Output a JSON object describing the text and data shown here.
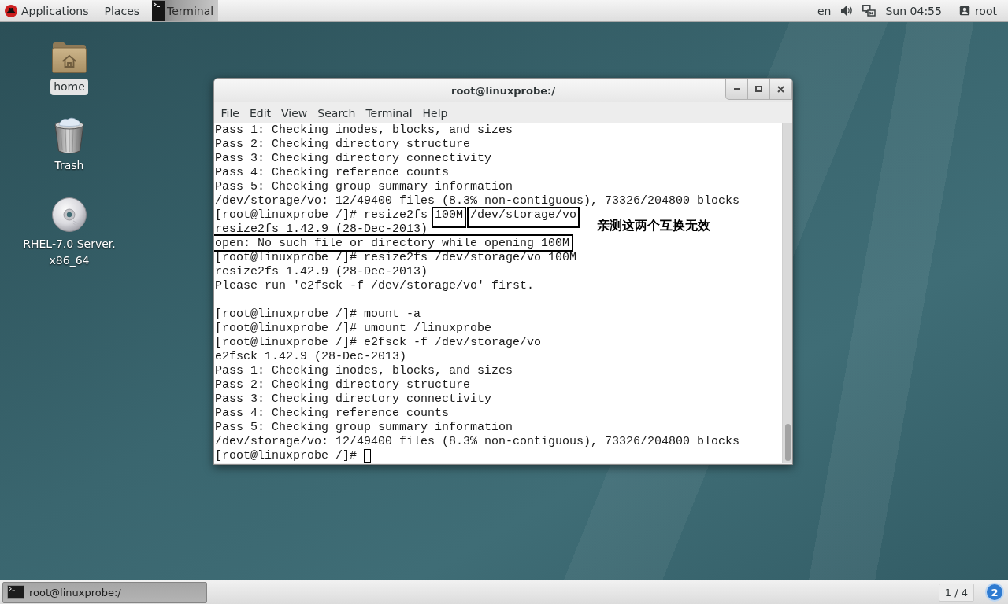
{
  "top_bar": {
    "menus": [
      {
        "kind": "apps",
        "label": "Applications"
      },
      {
        "kind": "places",
        "label": "Places"
      }
    ],
    "app_menu": {
      "label": "Terminal"
    },
    "input_source": "en",
    "clock": "Sun 04:55",
    "user": "root"
  },
  "desktop_icons": [
    {
      "kind": "folder",
      "label_lines": [
        "home"
      ],
      "selected": true
    },
    {
      "kind": "trash",
      "label_lines": [
        "Trash"
      ],
      "selected": false
    },
    {
      "kind": "disc",
      "label_lines": [
        "RHEL-7.0 Server.",
        "x86_64"
      ],
      "selected": false
    }
  ],
  "terminal": {
    "title": "root@linuxprobe:/",
    "menu": [
      "File",
      "Edit",
      "View",
      "Search",
      "Terminal",
      "Help"
    ],
    "lines": [
      {
        "kind": "text",
        "text": "Pass 1: Checking inodes, blocks, and sizes",
        "boxed": false
      },
      {
        "kind": "text",
        "text": "Pass 2: Checking directory structure",
        "boxed": false
      },
      {
        "kind": "text",
        "text": "Pass 3: Checking directory connectivity",
        "boxed": false
      },
      {
        "kind": "text",
        "text": "Pass 4: Checking reference counts",
        "boxed": false
      },
      {
        "kind": "text",
        "text": "Pass 5: Checking group summary information",
        "boxed": false
      },
      {
        "kind": "text",
        "text": "/dev/storage/vo: 12/49400 files (8.3% non-contiguous), 73326/204800 blocks",
        "boxed": false
      },
      {
        "kind": "parts",
        "parts": [
          {
            "text": "[root@linuxprobe /]# resize2fs",
            "boxed": false
          },
          {
            "text": "100M",
            "boxed": true
          },
          {
            "text": "/dev/storage/vo",
            "boxed": true
          }
        ]
      },
      {
        "kind": "text",
        "text": "resize2fs 1.42.9 (28-Dec-2013)",
        "boxed": false
      },
      {
        "kind": "text",
        "text": "open: No such file or directory while opening 100M",
        "boxed": true
      },
      {
        "kind": "text",
        "text": "[root@linuxprobe /]# resize2fs /dev/storage/vo 100M",
        "boxed": false
      },
      {
        "kind": "text",
        "text": "resize2fs 1.42.9 (28-Dec-2013)",
        "boxed": false
      },
      {
        "kind": "text",
        "text": "Please run 'e2fsck -f /dev/storage/vo' first.",
        "boxed": false
      },
      {
        "kind": "blank"
      },
      {
        "kind": "text",
        "text": "[root@linuxprobe /]# mount -a",
        "boxed": false
      },
      {
        "kind": "text",
        "text": "[root@linuxprobe /]# umount /linuxprobe",
        "boxed": false
      },
      {
        "kind": "text",
        "text": "[root@linuxprobe /]# e2fsck -f /dev/storage/vo",
        "boxed": false
      },
      {
        "kind": "text",
        "text": "e2fsck 1.42.9 (28-Dec-2013)",
        "boxed": false
      },
      {
        "kind": "text",
        "text": "Pass 1: Checking inodes, blocks, and sizes",
        "boxed": false
      },
      {
        "kind": "text",
        "text": "Pass 2: Checking directory structure",
        "boxed": false
      },
      {
        "kind": "text",
        "text": "Pass 3: Checking directory connectivity",
        "boxed": false
      },
      {
        "kind": "text",
        "text": "Pass 4: Checking reference counts",
        "boxed": false
      },
      {
        "kind": "text",
        "text": "Pass 5: Checking group summary information",
        "boxed": false
      },
      {
        "kind": "text",
        "text": "/dev/storage/vo: 12/49400 files (8.3% non-contiguous), 73326/204800 blocks",
        "boxed": false
      },
      {
        "kind": "prompt",
        "text": "[root@linuxprobe /]#",
        "cursor": true
      }
    ],
    "note": "亲测这两个互换无效"
  },
  "taskbar": {
    "windows": [
      {
        "label": "root@linuxprobe:/",
        "selected": true
      }
    ],
    "workspace": "1 / 4",
    "notifications": "2"
  }
}
